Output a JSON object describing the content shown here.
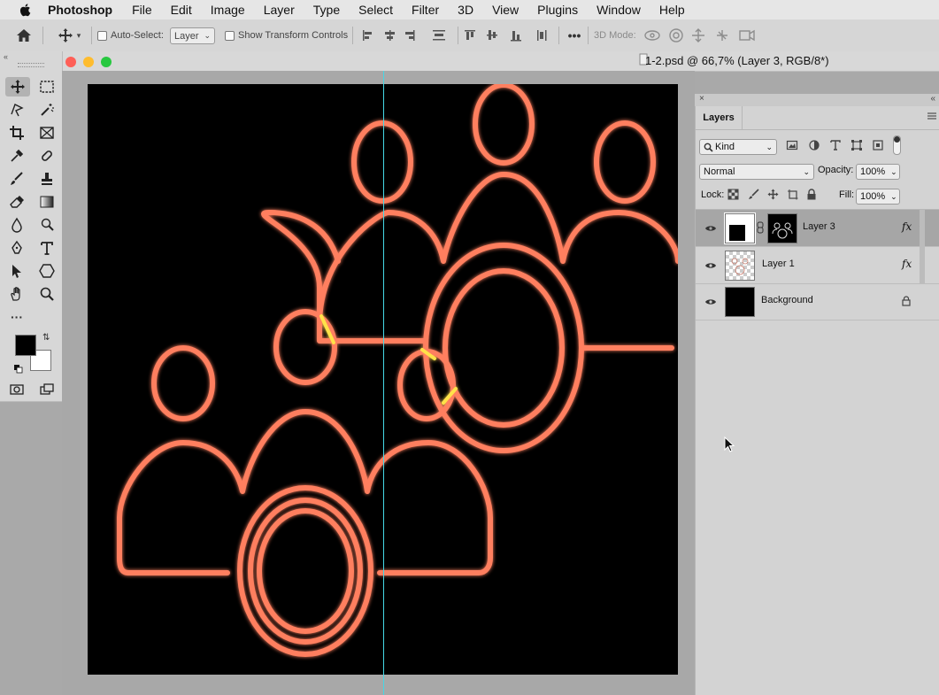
{
  "menubar": {
    "app_name": "Photoshop",
    "items": [
      "File",
      "Edit",
      "Image",
      "Layer",
      "Type",
      "Select",
      "Filter",
      "3D",
      "View",
      "Plugins",
      "Window",
      "Help"
    ]
  },
  "options_bar": {
    "auto_select_label": "Auto-Select:",
    "auto_select_target": "Layer",
    "show_transform_label": "Show Transform Controls",
    "more_label": "•••",
    "mode_3d_label": "3D Mode:"
  },
  "document": {
    "title": "1-2.psd @ 66,7% (Layer 3, RGB/8*)"
  },
  "layers_panel": {
    "tab_label": "Layers",
    "filter_kind": "Kind",
    "blend_mode": "Normal",
    "opacity_label": "Opacity:",
    "opacity_value": "100%",
    "lock_label": "Lock:",
    "fill_label": "Fill:",
    "fill_value": "100%",
    "layers": [
      {
        "name": "Layer 3",
        "fx": "fx",
        "selected": true
      },
      {
        "name": "Layer 1",
        "fx": "fx",
        "selected": false
      },
      {
        "name": "Background",
        "locked": true
      }
    ]
  },
  "colors": {
    "glow_outer": "#ff7f5f",
    "glow_inner": "#ffc2a6",
    "overlap": "#ffe24a",
    "guide": "#45d8e6",
    "selected_row": "#a6a6a6"
  }
}
